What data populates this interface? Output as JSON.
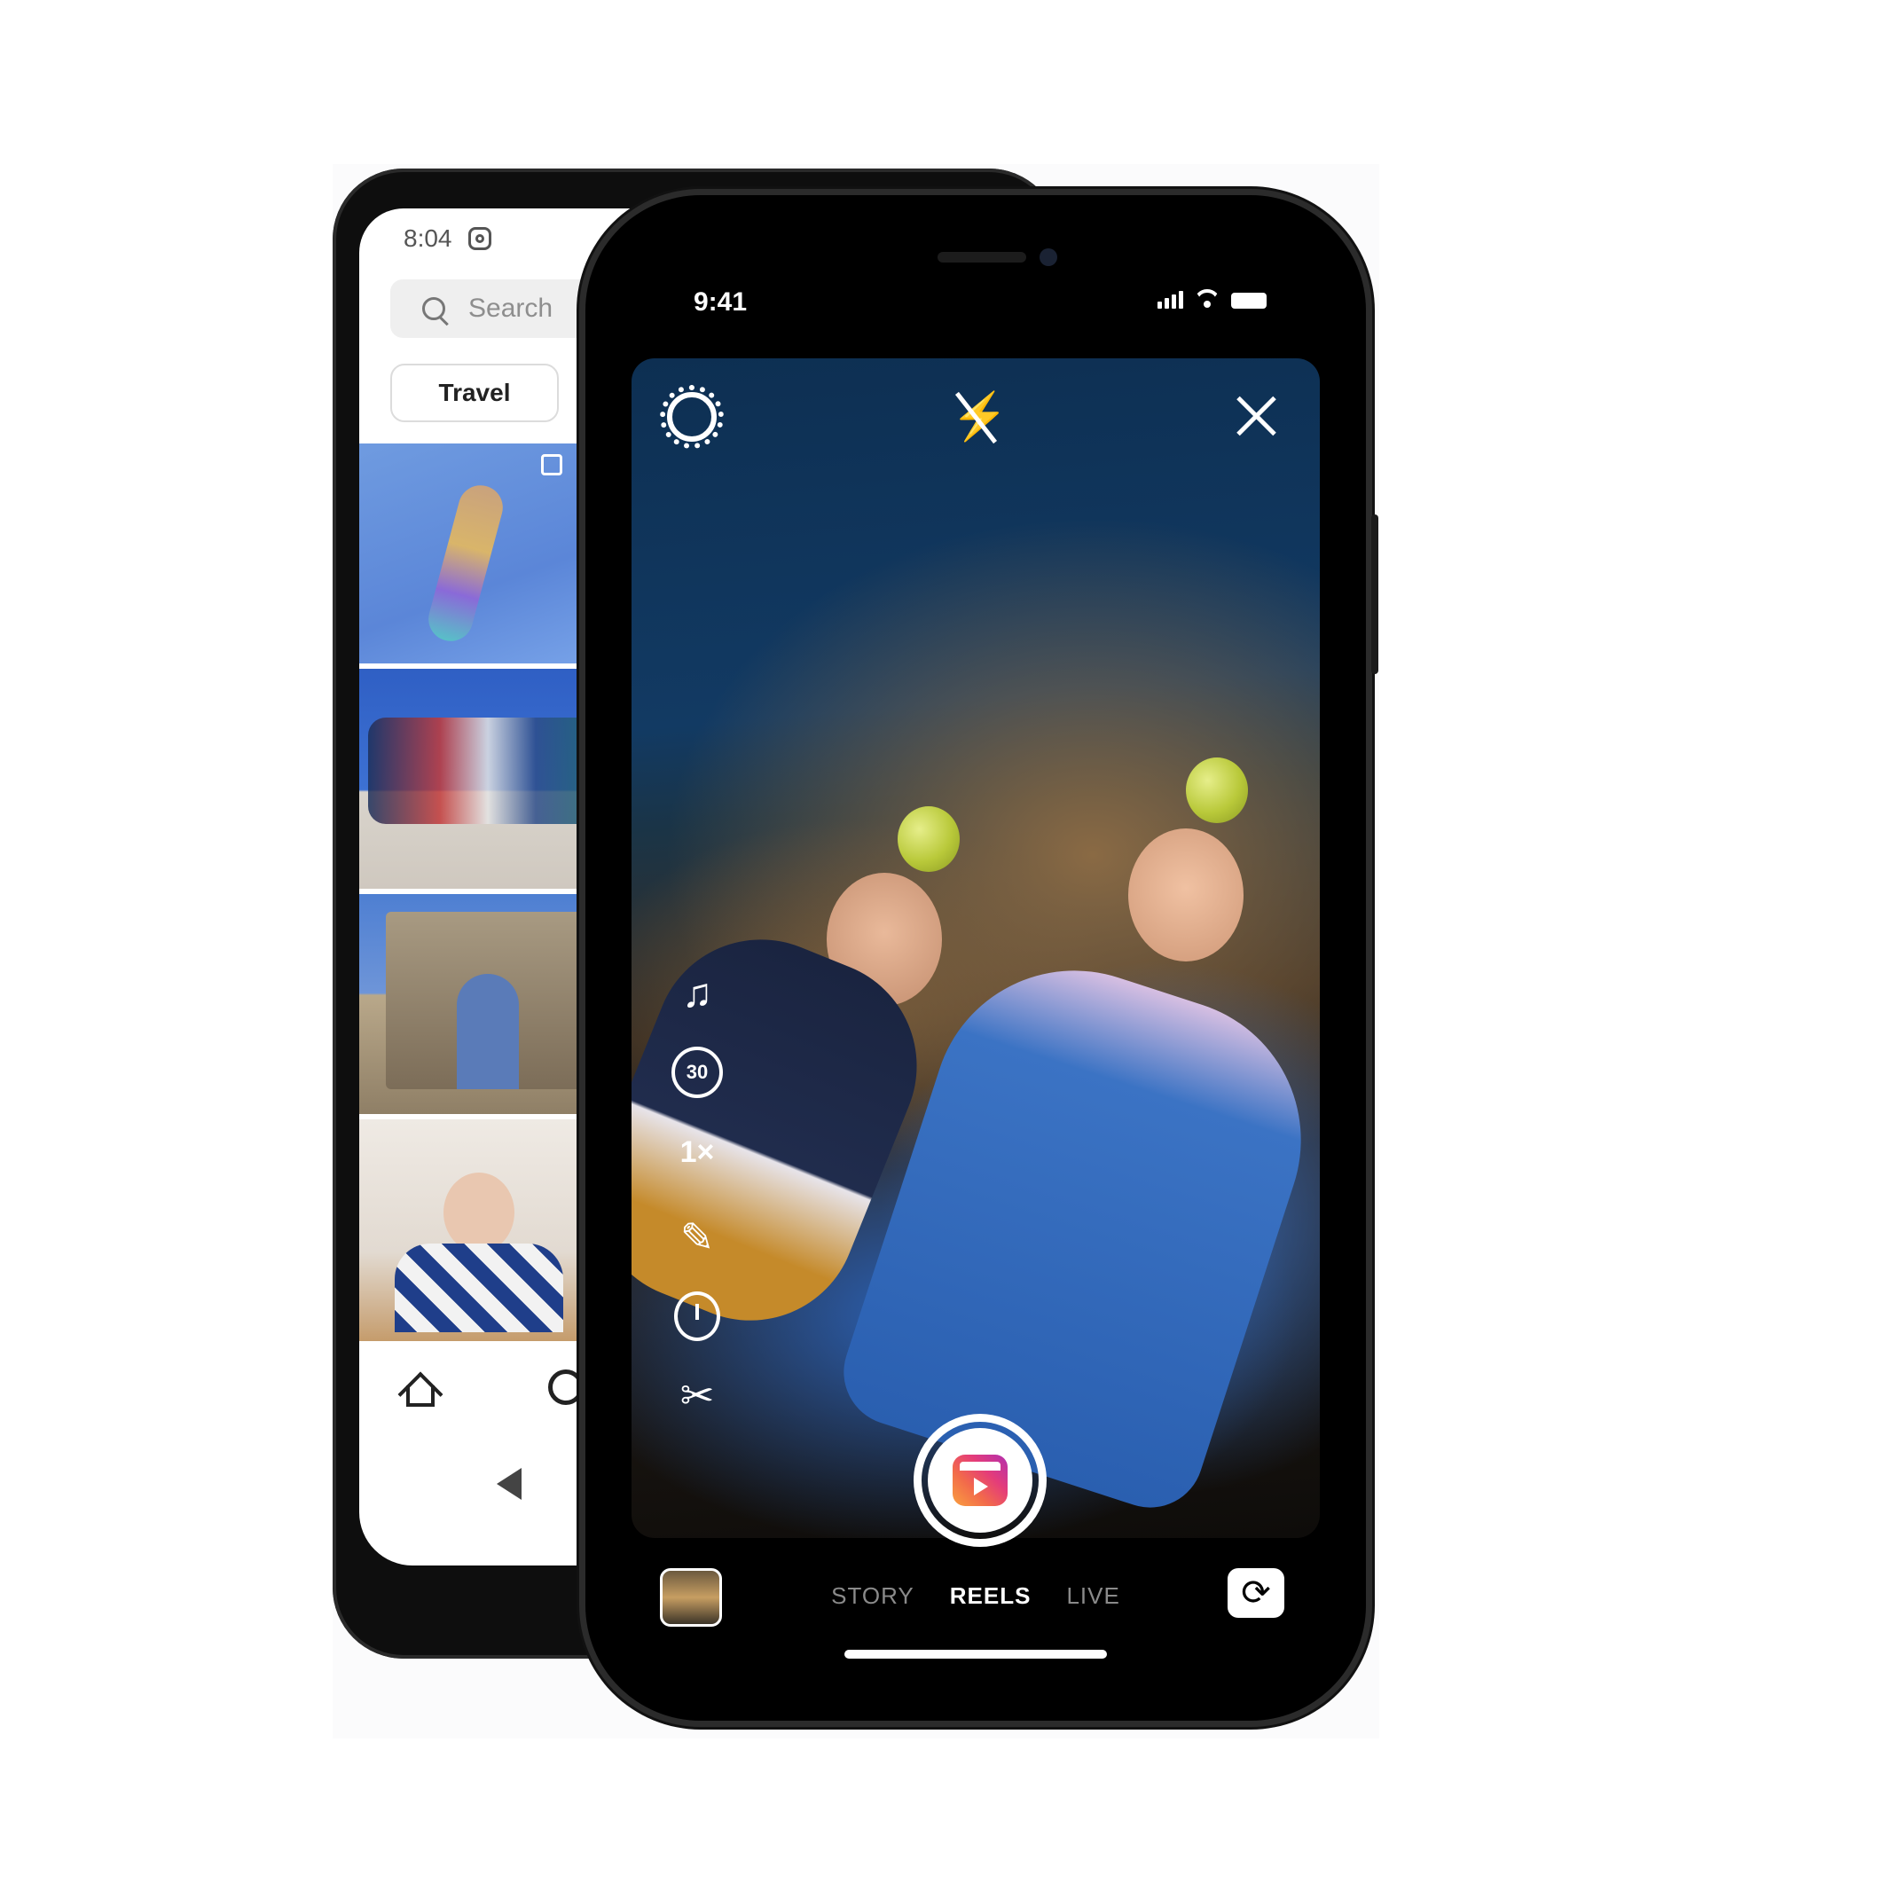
{
  "back_phone": {
    "status_time": "8:04",
    "search_placeholder": "Search",
    "chip_label": "Travel"
  },
  "front_phone": {
    "status_time": "9:41",
    "camera_tools": {
      "timer_length": "30",
      "speed": "1×"
    },
    "modes": [
      "STORY",
      "REELS",
      "LIVE"
    ],
    "active_mode": "REELS"
  },
  "icons": {
    "settings": "gear-icon",
    "flash": "flash-off-icon",
    "close": "close-icon",
    "music": "music-note-icon",
    "effects": "magic-wand-icon",
    "timer": "stopwatch-icon",
    "align": "scissors-icon",
    "capture": "reels-icon",
    "flip": "camera-flip-icon",
    "home": "home-icon",
    "search": "search-icon",
    "back": "back-arrow-icon"
  },
  "colors": {
    "reels_gradient": [
      "#f9a03f",
      "#e43c7a",
      "#b12fb0"
    ],
    "inactive_mode": "#8a8a8a",
    "active_mode": "#ffffff"
  }
}
